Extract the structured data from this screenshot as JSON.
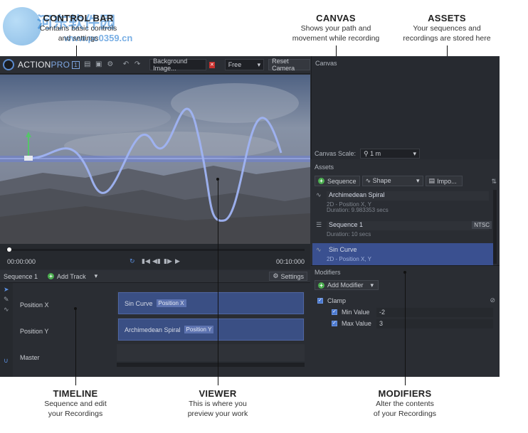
{
  "watermark": {
    "cn": "河东软件园",
    "url": "www.pc0359.cn"
  },
  "annotations": {
    "control_bar": {
      "title": "CONTROL BAR",
      "desc1": "Contains basic controls",
      "desc2": "and settings"
    },
    "canvas": {
      "title": "CANVAS",
      "desc1": "Shows your path and",
      "desc2": "movement while recording"
    },
    "assets": {
      "title": "ASSETS",
      "desc1": "Your sequences and",
      "desc2": "recordings are stored here"
    },
    "timeline": {
      "title": "TIMELINE",
      "desc1": "Sequence and edit",
      "desc2": "your Recordings"
    },
    "viewer": {
      "title": "VIEWER",
      "desc1": "This is where you",
      "desc2": "preview your work"
    },
    "modifiers": {
      "title": "MODIFIERS",
      "desc1": "Alter the contents",
      "desc2": "of your Recordings"
    }
  },
  "toolbar": {
    "brand_action": "ACTION",
    "brand_pro": "PRO",
    "brand_badge": "1",
    "background_label": "Background Image...",
    "camera_mode": "Free",
    "reset_camera": "Reset Camera"
  },
  "transport": {
    "time_start": "00:00:000",
    "time_end": "00:10:000"
  },
  "timeline": {
    "sequence": "Sequence 1",
    "add_track": "Add Track",
    "settings": "Settings",
    "tracks": [
      {
        "label": "Position X",
        "clip": "Sin Curve",
        "badge": "Position X"
      },
      {
        "label": "Position Y",
        "clip": "Archimedean Spiral",
        "badge": "Position Y"
      },
      {
        "label": "Master"
      }
    ]
  },
  "canvas_panel": {
    "title": "Canvas",
    "scale_label": "Canvas Scale:",
    "scale_value": "1 m"
  },
  "assets": {
    "title": "Assets",
    "sequence_btn": "Sequence",
    "shape_btn": "Shape",
    "import_btn": "Impo...",
    "items": [
      {
        "name": "Archimedean Spiral",
        "meta1": "2D - Position X, Y",
        "meta2": "Duration: 9.983353 secs"
      },
      {
        "name": "Sequence 1",
        "meta1": "Duration: 10 secs",
        "badge": "NTSC"
      },
      {
        "name": "Sin Curve",
        "meta1": "2D - Position X, Y"
      }
    ]
  },
  "modifiers": {
    "title": "Modifiers",
    "add_btn": "Add Modifier",
    "clamp": "Clamp",
    "min_label": "Min Value",
    "min_value": "-2",
    "max_label": "Max Value",
    "max_value": "3"
  },
  "colors": {
    "accent": "#3a5090",
    "panel": "#2a2d33",
    "path": "#8fa8ec"
  }
}
